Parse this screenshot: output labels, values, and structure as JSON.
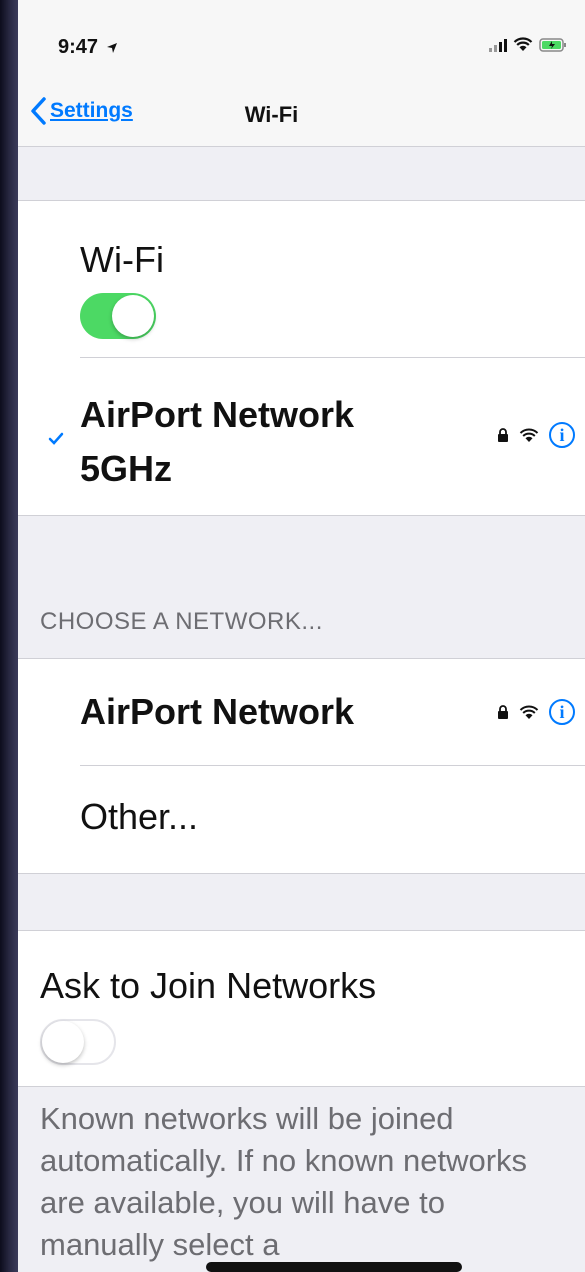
{
  "status": {
    "time": "9:47",
    "location_icon": "location-arrow-icon",
    "signal_icon": "cellular-signal-icon",
    "wifi_icon": "wifi-icon",
    "battery_icon": "battery-charging-icon"
  },
  "nav": {
    "back_label": "Settings",
    "title": "Wi-Fi"
  },
  "wifi_section": {
    "label": "Wi-Fi",
    "toggle_on": true,
    "connected_network": {
      "name_line1": "AirPort Network",
      "name_line2": "5GHz",
      "secured": true,
      "info_symbol": "i"
    }
  },
  "choose_section": {
    "header": "CHOOSE A NETWORK...",
    "networks": [
      {
        "name": "AirPort Network",
        "secured": true,
        "info_symbol": "i"
      }
    ],
    "other_label": "Other..."
  },
  "ask_section": {
    "label": "Ask to Join Networks",
    "toggle_on": false,
    "footer": "Known networks will be joined automatically. If no known networks are available, you will have to manually select a"
  },
  "colors": {
    "accent": "#007aff",
    "toggle_on": "#4cd964",
    "background": "#efeff4"
  }
}
